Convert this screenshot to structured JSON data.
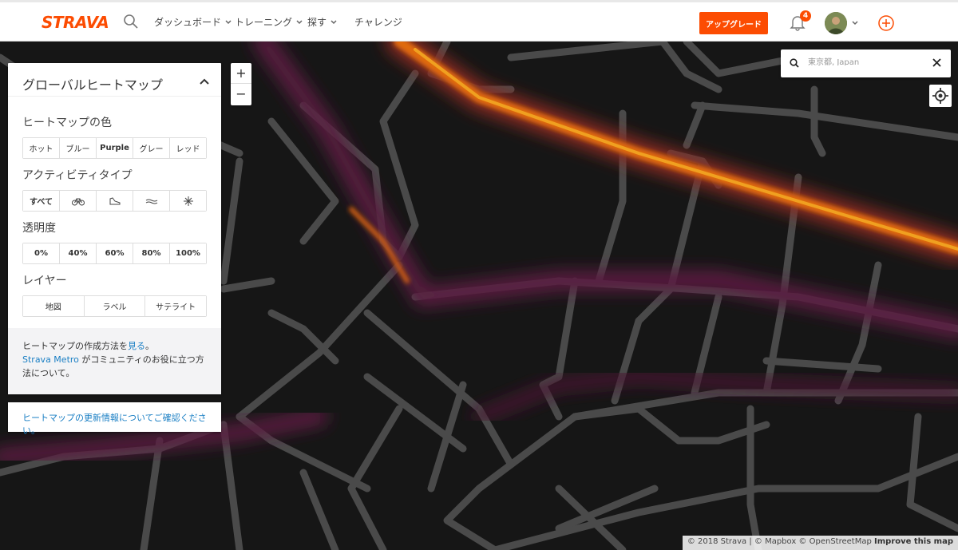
{
  "brand": "STRAVA",
  "nav": [
    "ダッシュボード",
    "トレーニング",
    "探す",
    "チャレンジ"
  ],
  "upgrade_label": "アップグレード",
  "notifications_count": "4",
  "panel": {
    "title": "グローバルヒートマップ",
    "color_label": "ヒートマップの色",
    "colors": [
      "ホット",
      "ブルー",
      "Purple",
      "グレー",
      "レッド"
    ],
    "selected_color": "Purple",
    "activity_label": "アクティビティタイプ",
    "activity_all": "すべて",
    "activity_icons": [
      "bike-icon",
      "run-shoe-icon",
      "water-icon",
      "winter-icon"
    ],
    "opacity_label": "透明度",
    "opacity": [
      "0%",
      "40%",
      "60%",
      "80%",
      "100%"
    ],
    "layer_label": "レイヤー",
    "layers": [
      "地図",
      "ラベル",
      "サテライト"
    ],
    "foot1_a": "ヒートマップの作成方法を",
    "foot1_link": "見る",
    "foot1_b": "。",
    "foot2_link": "Strava Metro",
    "foot2_b": " がコミュニティのお役に立つ方法について。",
    "update_link": "ヒートマップの更新情報についてご確認ください。"
  },
  "map_search": {
    "value": "東京都, Japan"
  },
  "attribution": {
    "text": "© 2018 Strava | © Mapbox © OpenStreetMap",
    "improve": "Improve this map"
  },
  "colors": {
    "accent": "#fc4c02",
    "link": "#1a7fc4",
    "map_bg": "#1a1a1a"
  }
}
